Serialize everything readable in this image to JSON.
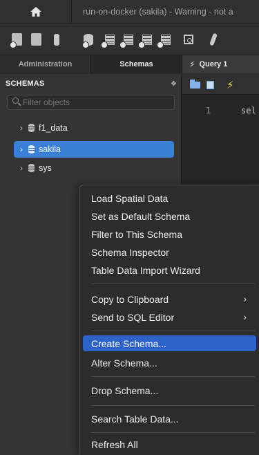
{
  "titlebar": {
    "home_icon": "home-icon",
    "connection_title": "run-on-docker (sakila) - Warning - not a"
  },
  "toolbar": {
    "icons": [
      "new-sql-tab-icon",
      "open-sql-script-icon",
      "open-inspector-icon",
      "create-schema-icon",
      "create-table-icon",
      "create-view-icon",
      "create-procedure-icon",
      "create-function-icon",
      "search-table-data-icon",
      "reconnect-icon"
    ]
  },
  "tabs": {
    "administration": "Administration",
    "schemas": "Schemas",
    "query": "Query 1"
  },
  "sidebar": {
    "header": "SCHEMAS",
    "filter_placeholder": "Filter objects",
    "schemas": [
      {
        "name": "f1_data",
        "selected": false
      },
      {
        "name": "sakila",
        "selected": true
      },
      {
        "name": "sys",
        "selected": false
      }
    ]
  },
  "editor": {
    "line_number": "1",
    "code": "sel"
  },
  "context_menu": {
    "items": {
      "load_spatial": "Load Spatial Data",
      "set_default": "Set as Default Schema",
      "filter_schema": "Filter to This Schema",
      "inspector": "Schema Inspector",
      "import_wizard": "Table Data Import Wizard",
      "copy_clipboard": "Copy to Clipboard",
      "send_sql": "Send to SQL Editor",
      "create_schema": "Create Schema...",
      "alter_schema": "Alter Schema...",
      "drop_schema": "Drop Schema...",
      "search_data": "Search Table Data...",
      "refresh_all": "Refresh All"
    },
    "highlighted": "Create Schema..."
  },
  "colors": {
    "selection": "#3a7fd6",
    "menu_highlight": "#2d63c8",
    "background": "#2a2a2a"
  }
}
